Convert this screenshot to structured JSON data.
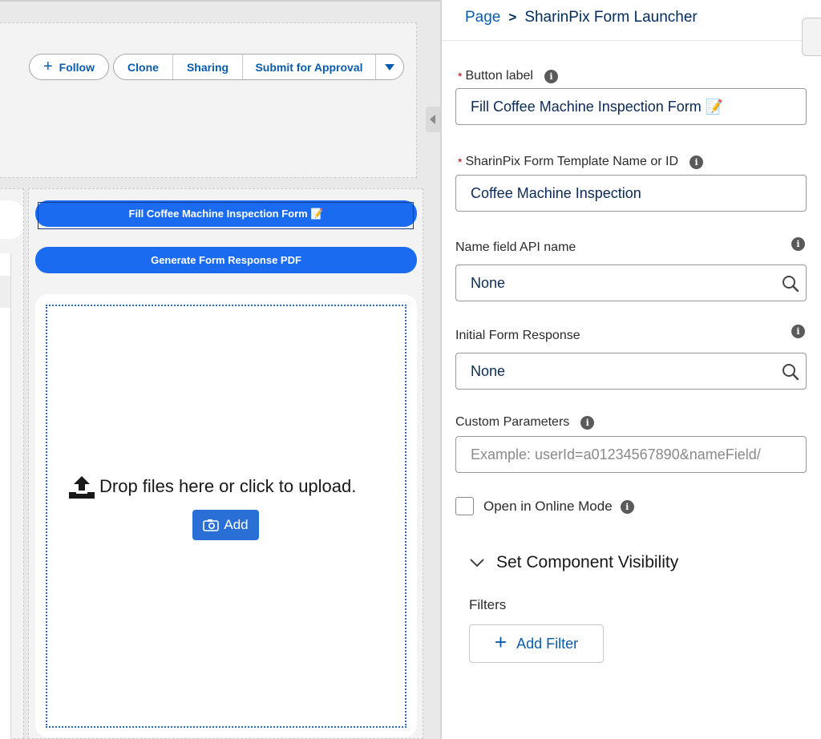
{
  "record_header": {
    "follow_label": "Follow",
    "actions": [
      "Clone",
      "Sharing",
      "Submit for Approval"
    ]
  },
  "canvas": {
    "fill_form_button": "Fill Coffee Machine Inspection Form 📝",
    "generate_pdf_button": "Generate Form Response PDF",
    "drop_text": "Drop files here or click to upload.",
    "add_label": "Add"
  },
  "panel": {
    "breadcrumb_page": "Page",
    "breadcrumb_sep": ">",
    "title": "SharinPix Form Launcher",
    "fields": {
      "button_label": {
        "label": "Button label",
        "required": "*",
        "value": "Fill Coffee Machine Inspection Form 📝"
      },
      "template": {
        "label": "SharinPix Form Template Name or ID",
        "required": "*",
        "value": "Coffee Machine Inspection"
      },
      "name_field": {
        "label": "Name field API name",
        "value": "None"
      },
      "initial_response": {
        "label": "Initial Form Response",
        "value": "None"
      },
      "custom_params": {
        "label": "Custom Parameters",
        "placeholder": "Example: userId=a01234567890&nameField/"
      }
    },
    "online_mode_label": "Open in Online Mode",
    "visibility_section": "Set Component Visibility",
    "filters_label": "Filters",
    "add_filter_label": "Add Filter"
  },
  "colors": {
    "brand_blue": "#1b6bf0",
    "link_blue": "#0b5cab",
    "navy": "#032d60",
    "required_red": "#ba0517"
  }
}
